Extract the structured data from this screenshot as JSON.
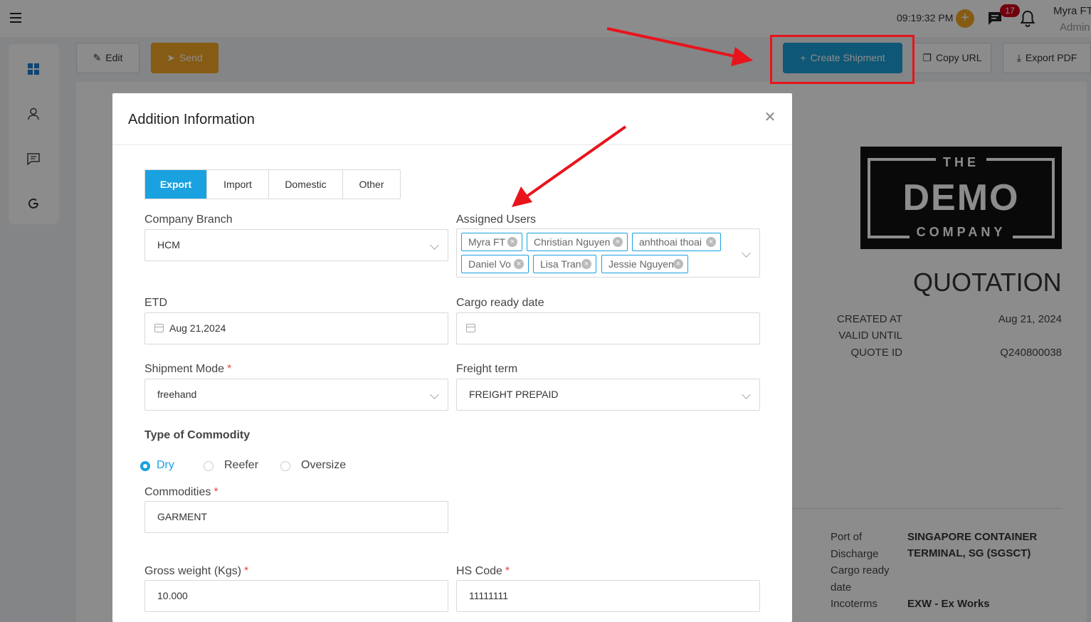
{
  "header": {
    "time": "09:19:32 PM",
    "notification_count": "17",
    "user_name": "Myra FT",
    "user_role": "Admin"
  },
  "toolbar": {
    "edit_label": "Edit",
    "send_label": "Send",
    "create_shipment_label": "Create Shipment",
    "copy_url_label": "Copy URL",
    "export_pdf_label": "Export PDF"
  },
  "document": {
    "logo_top": "THE",
    "logo_main": "DEMO",
    "logo_bottom": "COMPANY",
    "title": "QUOTATION",
    "meta": [
      {
        "label": "CREATED AT",
        "value": "Aug 21, 2024"
      },
      {
        "label": "VALID UNTIL",
        "value": ""
      },
      {
        "label": "QUOTE ID",
        "value": "Q240800038"
      }
    ],
    "info": {
      "port_of_discharge_label": "Port of Discharge",
      "port_of_discharge_line1": "SINGAPORE CONTAINER",
      "port_of_discharge_line2": "TERMINAL, SG (SGSCT)",
      "cargo_ready_label_1": "Cargo ready",
      "cargo_ready_label_2": "date",
      "incoterms_label": "Incoterms",
      "incoterms_value": "EXW - Ex Works"
    }
  },
  "modal": {
    "title": "Addition Information",
    "tabs": [
      {
        "label": "Export",
        "active": true
      },
      {
        "label": "Import",
        "active": false
      },
      {
        "label": "Domestic",
        "active": false
      },
      {
        "label": "Other",
        "active": false
      }
    ],
    "company_branch": {
      "label": "Company Branch",
      "value": "HCM"
    },
    "assigned_users": {
      "label": "Assigned Users",
      "users": [
        "Myra FT",
        "Christian Nguyen",
        "anhthoai thoai",
        "Daniel Vo",
        "Lisa Tran",
        "Jessie Nguyen"
      ]
    },
    "etd": {
      "label": "ETD",
      "value": "Aug 21,2024"
    },
    "cargo_ready_date": {
      "label": "Cargo ready date",
      "value": ""
    },
    "shipment_mode": {
      "label": "Shipment Mode",
      "required": "*",
      "value": "freehand"
    },
    "freight_term": {
      "label": "Freight term",
      "value": "FREIGHT PREPAID"
    },
    "commodity_type": {
      "label": "Type of Commodity",
      "options": [
        "Dry",
        "Reefer",
        "Oversize"
      ],
      "selected": "Dry"
    },
    "commodities": {
      "label": "Commodities",
      "required": "*",
      "value": "GARMENT"
    },
    "gross_weight": {
      "label": "Gross weight (Kgs)",
      "required": "*",
      "value": "10.000"
    },
    "hs_code": {
      "label": "HS Code",
      "required": "*",
      "value": "11111111"
    }
  },
  "colors": {
    "primary": "#1aa1e0",
    "send": "#f5a623",
    "danger": "#d0021b",
    "annotation": "#e8141c"
  }
}
